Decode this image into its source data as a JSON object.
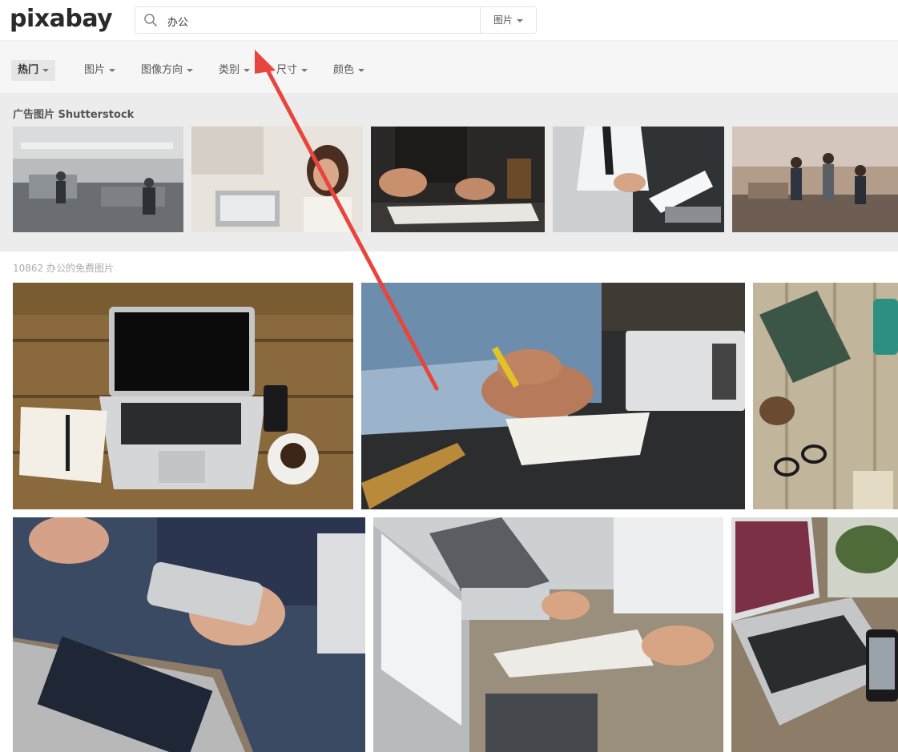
{
  "header": {
    "logo_text": "pixabay",
    "search": {
      "value": "办公",
      "type_label": "图片"
    }
  },
  "filters": [
    {
      "label": "热门",
      "active": true
    },
    {
      "label": "图片"
    },
    {
      "label": "图像方向"
    },
    {
      "label": "类别"
    },
    {
      "label": "尺寸"
    },
    {
      "label": "颜色"
    }
  ],
  "ads": {
    "title": "广告图片 Shutterstock",
    "images": [
      "office-team",
      "woman-laptop",
      "signing-documents",
      "businessman-writing",
      "team-celebrating"
    ]
  },
  "results": {
    "count_text": "10862 办公的免费图片",
    "photos": [
      "laptop-desk-top-view",
      "man-writing-notes",
      "notebook-glasses-wood",
      "woman-phone-laptop",
      "meeting-laptops-writing",
      "laptop-smartphone-plant"
    ]
  },
  "colors": {
    "accent": "#e8453c",
    "bg": "#f6f6f6"
  }
}
